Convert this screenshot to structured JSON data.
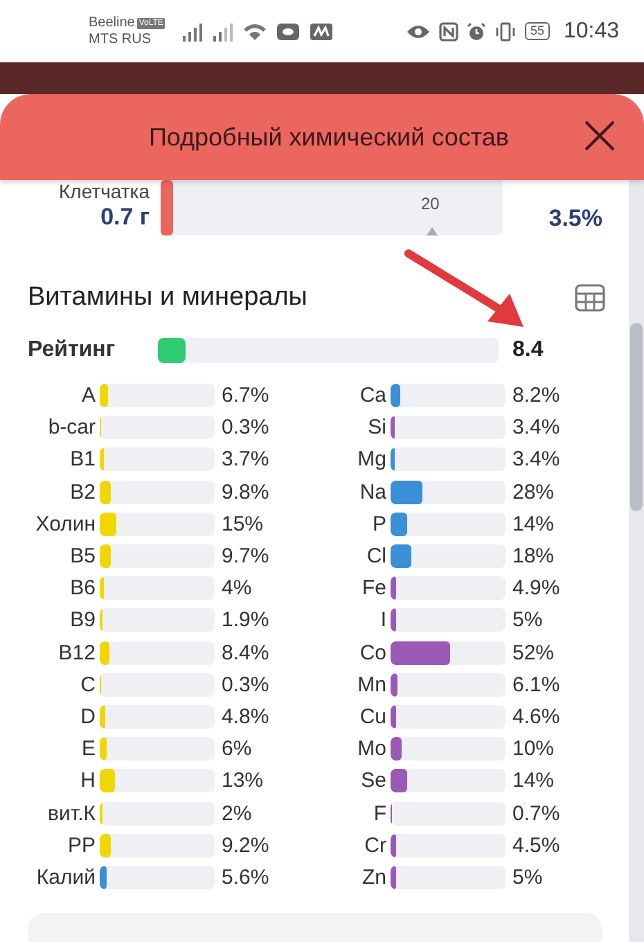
{
  "status_bar": {
    "carrier_1": "Beeline",
    "volte": "VoLTE",
    "carrier_2": "MTS RUS",
    "battery": "55",
    "time": "10:43"
  },
  "dialog": {
    "title": "Подробный химический состав"
  },
  "fiber": {
    "name": "Клетчатка",
    "amount": "0.7 г",
    "level": 0.035,
    "marker": "20",
    "percent": "3.5%"
  },
  "section": {
    "title": "Витамины и минералы"
  },
  "rating": {
    "label": "Рейтинг",
    "level": 0.08,
    "value": "8.4"
  },
  "vitamins": [
    {
      "name": "A",
      "level": 0.067,
      "value": "6.7%",
      "color": "#f2d600"
    },
    {
      "name": "b-car",
      "level": 0.003,
      "value": "0.3%",
      "color": "#f2d600"
    },
    {
      "name": "B1",
      "level": 0.037,
      "value": "3.7%",
      "color": "#f2d600"
    },
    {
      "name": "B2",
      "level": 0.098,
      "value": "9.8%",
      "color": "#f2d600"
    },
    {
      "name": "Холин",
      "level": 0.15,
      "value": "15%",
      "color": "#f2d600"
    },
    {
      "name": "B5",
      "level": 0.097,
      "value": "9.7%",
      "color": "#f2d600"
    },
    {
      "name": "B6",
      "level": 0.04,
      "value": "4%",
      "color": "#f2d600"
    },
    {
      "name": "B9",
      "level": 0.019,
      "value": "1.9%",
      "color": "#f2d600"
    },
    {
      "name": "B12",
      "level": 0.084,
      "value": "8.4%",
      "color": "#f2d600"
    },
    {
      "name": "C",
      "level": 0.003,
      "value": "0.3%",
      "color": "#f2d600"
    },
    {
      "name": "D",
      "level": 0.048,
      "value": "4.8%",
      "color": "#f2d600"
    },
    {
      "name": "E",
      "level": 0.06,
      "value": "6%",
      "color": "#f2d600"
    },
    {
      "name": "H",
      "level": 0.13,
      "value": "13%",
      "color": "#f2d600"
    },
    {
      "name": "вит.К",
      "level": 0.02,
      "value": "2%",
      "color": "#f2d600"
    },
    {
      "name": "PP",
      "level": 0.092,
      "value": "9.2%",
      "color": "#f2d600"
    },
    {
      "name": "Калий",
      "level": 0.056,
      "value": "5.6%",
      "color": "#3a8fd6"
    }
  ],
  "minerals": [
    {
      "name": "Ca",
      "level": 0.082,
      "value": "8.2%",
      "color": "#3a8fd6"
    },
    {
      "name": "Si",
      "level": 0.034,
      "value": "3.4%",
      "color": "#9b59b6"
    },
    {
      "name": "Mg",
      "level": 0.034,
      "value": "3.4%",
      "color": "#3a8fd6"
    },
    {
      "name": "Na",
      "level": 0.28,
      "value": "28%",
      "color": "#3a8fd6"
    },
    {
      "name": "P",
      "level": 0.14,
      "value": "14%",
      "color": "#3a8fd6"
    },
    {
      "name": "Cl",
      "level": 0.18,
      "value": "18%",
      "color": "#3a8fd6"
    },
    {
      "name": "Fe",
      "level": 0.049,
      "value": "4.9%",
      "color": "#9b59b6"
    },
    {
      "name": "I",
      "level": 0.05,
      "value": "5%",
      "color": "#9b59b6"
    },
    {
      "name": "Co",
      "level": 0.52,
      "value": "52%",
      "color": "#9b59b6"
    },
    {
      "name": "Mn",
      "level": 0.061,
      "value": "6.1%",
      "color": "#9b59b6"
    },
    {
      "name": "Cu",
      "level": 0.046,
      "value": "4.6%",
      "color": "#9b59b6"
    },
    {
      "name": "Mo",
      "level": 0.1,
      "value": "10%",
      "color": "#9b59b6"
    },
    {
      "name": "Se",
      "level": 0.14,
      "value": "14%",
      "color": "#9b59b6"
    },
    {
      "name": "F",
      "level": 0.007,
      "value": "0.7%",
      "color": "#9b59b6"
    },
    {
      "name": "Cr",
      "level": 0.045,
      "value": "4.5%",
      "color": "#9b59b6"
    },
    {
      "name": "Zn",
      "level": 0.05,
      "value": "5%",
      "color": "#9b59b6"
    }
  ]
}
